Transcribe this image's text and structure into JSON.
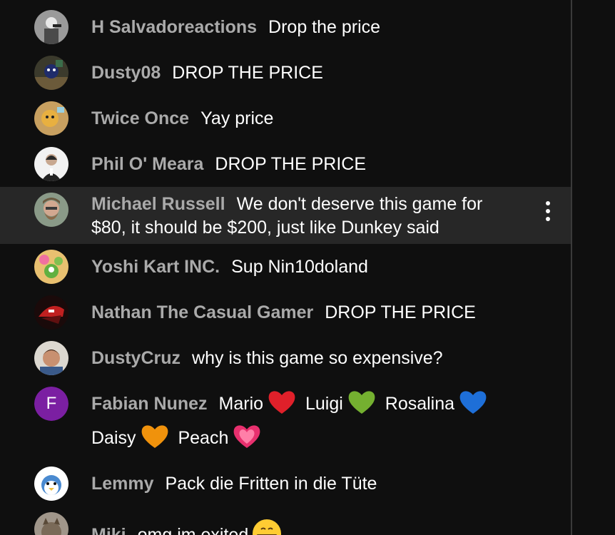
{
  "messages": [
    {
      "author": "H Salvadoreactions",
      "text": "Drop the price"
    },
    {
      "author": "Dusty08",
      "text": "DROP THE PRICE"
    },
    {
      "author": "Twice Once",
      "text": "Yay price"
    },
    {
      "author": "Phil O' Meara",
      "text": "DROP THE PRICE"
    },
    {
      "author": "Michael Russell",
      "text": "We don't deserve this game for $80, it should be $200, just like Dunkey said"
    },
    {
      "author": "Yoshi Kart INC.",
      "text": "Sup Nin10doland"
    },
    {
      "author": "Nathan The Casual Gamer",
      "text": "DROP THE PRICE"
    },
    {
      "author": "DustyCruz",
      "text": "why is this game so expensive?"
    },
    {
      "author": "Fabian Nunez",
      "avatar_letter": "F",
      "parts": [
        "Mario",
        "Luigi",
        "Rosalina",
        "Daisy",
        "Peach"
      ],
      "emojis": [
        "red-heart",
        "green-heart",
        "blue-heart",
        "orange-heart",
        "pink-heart"
      ]
    },
    {
      "author": "Lemmy",
      "text": "Pack die Fritten in die Tüte"
    },
    {
      "author": "Miki",
      "text": "omg im exited"
    }
  ],
  "colors": {
    "background": "#0f0f0f",
    "highlight": "#272727",
    "author": "#aaaaaa",
    "text": "#ffffff",
    "avatar_letter_bg": "#7b1fa2"
  }
}
